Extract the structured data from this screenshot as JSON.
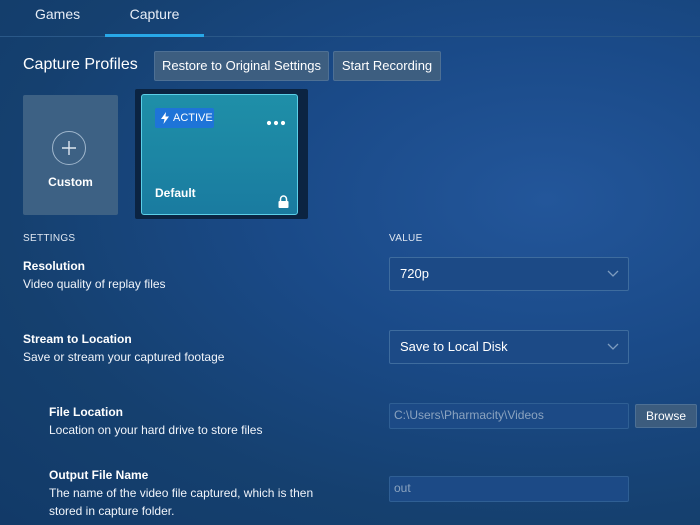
{
  "tabs": [
    {
      "label": "Games"
    },
    {
      "label": "Capture",
      "active": true
    }
  ],
  "profiles": {
    "heading": "Capture Profiles",
    "restore_label": "Restore to Original Settings",
    "record_label": "Start Recording",
    "custom_label": "Custom",
    "default_label": "Default",
    "active_badge": "ACTIVE"
  },
  "columns": {
    "settings": "SETTINGS",
    "value": "VALUE"
  },
  "settings": {
    "resolution": {
      "title": "Resolution",
      "description": "Video quality of replay files",
      "value": "720p"
    },
    "stream": {
      "title": "Stream to Location",
      "description": "Save or stream your captured footage",
      "value": "Save to Local Disk"
    },
    "file_location": {
      "title": "File Location",
      "description": "Location on your hard drive to store files",
      "value": "C:\\Users\\Pharmacity\\Videos",
      "browse_label": "Browse"
    },
    "output_name": {
      "title": "Output File Name",
      "description_line1": "The name of the video file captured, which is then",
      "description_line2": "stored in capture folder.",
      "value": "out"
    }
  },
  "colors": {
    "accent": "#28a8e8",
    "active_badge": "#1e74d8",
    "active_card": "#1f8fa8"
  },
  "icons": [
    "plus-icon",
    "lightning-icon",
    "more-icon",
    "lock-icon",
    "chevron-down-icon"
  ]
}
